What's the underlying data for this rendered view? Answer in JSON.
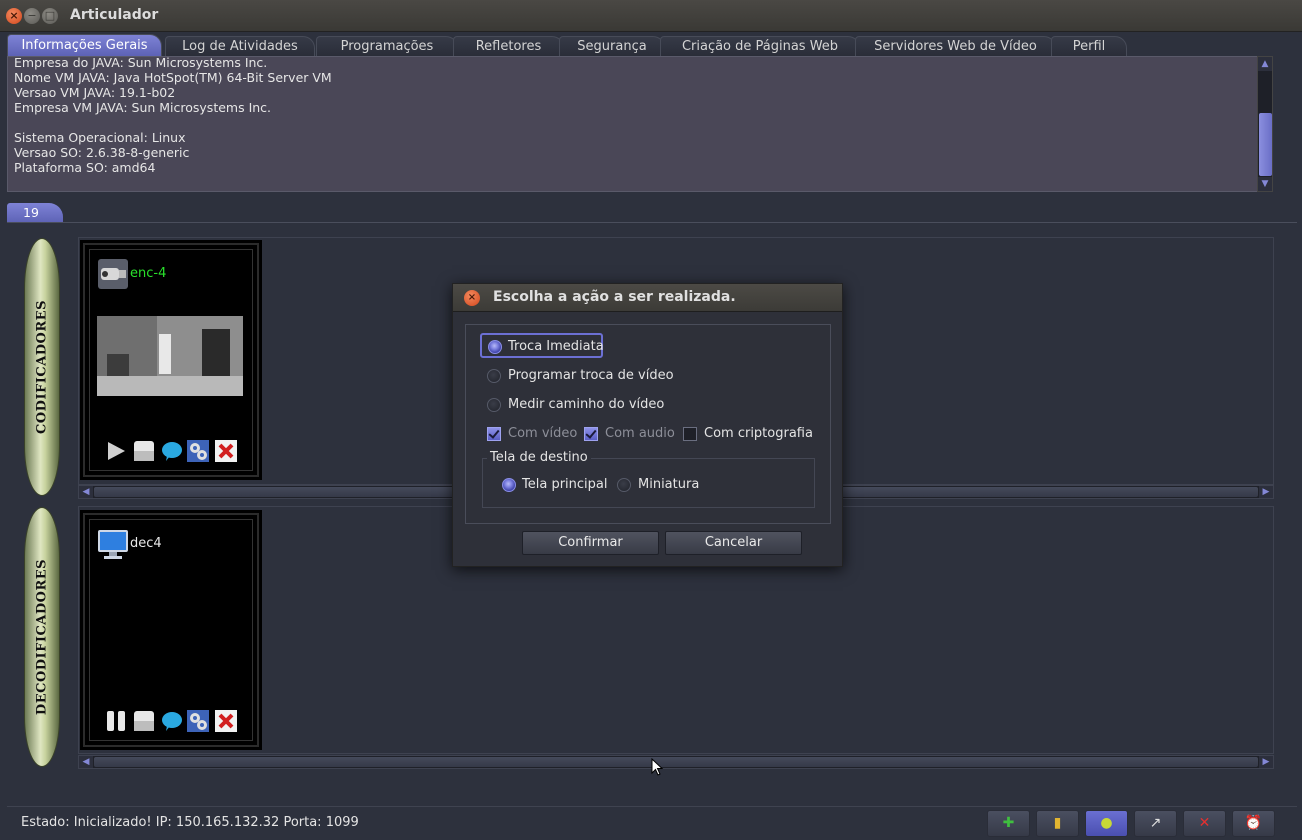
{
  "window": {
    "title": "Articulador",
    "close_glyph": "×",
    "min_glyph": "−",
    "max_glyph": "□"
  },
  "tabs": [
    {
      "label": "Informações Gerais",
      "active": true
    },
    {
      "label": "Log de Atividades"
    },
    {
      "label": "Programações"
    },
    {
      "label": "Refletores"
    },
    {
      "label": "Segurança"
    },
    {
      "label": "Criação de Páginas Web"
    },
    {
      "label": "Servidores Web de Vídeo"
    },
    {
      "label": "Perfil"
    }
  ],
  "info_lines": [
    "Empresa do JAVA: Sun Microsystems Inc.",
    "Nome VM JAVA: Java HotSpot(TM) 64-Bit Server VM",
    "Versao VM JAVA: 19.1-b02",
    "Empresa VM JAVA: Sun Microsystems Inc.",
    "",
    "Sistema Operacional: Linux",
    "Versao SO: 2.6.38-8-generic",
    "Plataforma SO: amd64"
  ],
  "group_tab": "19",
  "encoders": {
    "side_label": "CODIFICADORES",
    "card": {
      "name": "enc-4",
      "name_color": "#29e02b",
      "icon": "camera-icon"
    }
  },
  "decoders": {
    "side_label": "DECODIFICADORES",
    "card": {
      "name": "dec4",
      "name_color": "#e8e8e8",
      "icon": "monitor-icon"
    }
  },
  "dialog": {
    "title": "Escolha a ação a ser realizada.",
    "options": {
      "troca_imediata": "Troca Imediata",
      "programar": "Programar troca de vídeo",
      "medir": "Medir caminho do vídeo"
    },
    "checks": {
      "com_video": "Com vídeo",
      "com_audio": "Com audio",
      "com_cripto": "Com criptografia"
    },
    "destino": {
      "legend": "Tela de destino",
      "principal": "Tela principal",
      "miniatura": "Miniatura"
    },
    "confirm": "Confirmar",
    "cancel": "Cancelar",
    "close_glyph": "×"
  },
  "status": {
    "text": "Estado: Inicializado! IP: 150.165.132.32 Porta: 1099"
  },
  "status_buttons": [
    {
      "icon": "plus-icon",
      "glyph": "✚",
      "color": "#3fbf3f"
    },
    {
      "icon": "bookmark-icon",
      "glyph": "▮",
      "color": "#e2b531"
    },
    {
      "icon": "play-icon",
      "glyph": "●",
      "color": "#c8d836"
    },
    {
      "icon": "arrow-icon",
      "glyph": "↗",
      "color": "#e0e0e0"
    },
    {
      "icon": "close-icon",
      "glyph": "✕",
      "color": "#e23030"
    },
    {
      "icon": "alarm-icon",
      "glyph": "⏰",
      "color": "#e23030"
    }
  ]
}
